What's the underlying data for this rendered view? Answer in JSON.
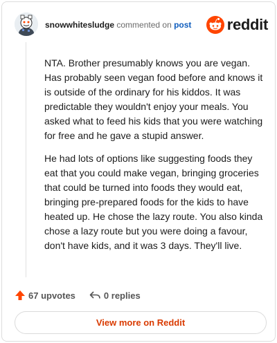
{
  "header": {
    "username": "snowwhitesludge",
    "action_text": "commented on",
    "post_link": "post",
    "brand_name": "reddit"
  },
  "comment": {
    "paragraphs": [
      "NTA. Brother presumably knows you are vegan. Has probably seen vegan food before and knows it is outside of the ordinary for his kiddos. It was predictable they wouldn't enjoy your meals. You asked what to feed his kids that you were watching for free and he gave a stupid answer.",
      "He had lots of options like suggesting foods they eat that you could make vegan, bringing groceries that could be turned into foods they would eat, bringing pre-prepared foods for the kids to have heated up. He chose the lazy route. You also kinda chose a lazy route but you were doing a favour, don't have kids, and it was 3 days. They'll live."
    ]
  },
  "actions": {
    "upvotes_label": "67 upvotes",
    "replies_label": "0 replies"
  },
  "view_more_label": "View more on Reddit",
  "colors": {
    "brand_orange": "#ff4500",
    "link_blue": "#0f5dbd",
    "view_more_text": "#d93a00",
    "upvote_arrow": "#ff4500"
  },
  "icons": {
    "avatar": "snoo-avatar",
    "brand_logo": "reddit-snoo-logo",
    "upvote": "upvote-arrow-icon",
    "reply": "reply-arrow-icon"
  }
}
